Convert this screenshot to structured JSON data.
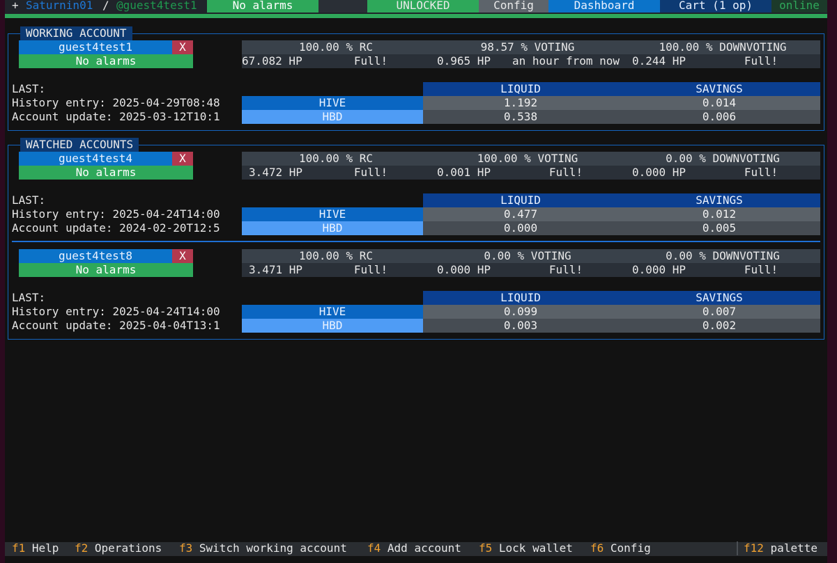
{
  "header": {
    "plus": "+",
    "profile": "Saturnin01",
    "slash": "/",
    "account": "@guest4test1",
    "alarms": "No alarms",
    "lock_status": "UNLOCKED",
    "config": "Config",
    "dashboard": "Dashboard",
    "cart": "Cart (1 op)",
    "status": "online"
  },
  "working": {
    "title": "WORKING ACCOUNT",
    "name": "guest4test1",
    "remove": "X",
    "alarms": "No alarms",
    "rc": "100.00 % RC",
    "voting": "98.57 % VOTING",
    "downvoting": "100.00 % DOWNVOTING",
    "hp": "67.082 HP",
    "hp_status": "Full!",
    "voting_hp": "0.965 HP",
    "voting_status": "an hour from now",
    "down_hp": "0.244 HP",
    "down_status": "Full!",
    "last": "LAST:",
    "history": "History entry: 2025-04-29T08:48",
    "update": "Account update: 2025-03-12T10:1",
    "liquid": "LIQUID",
    "savings": "SAVINGS",
    "hive": "HIVE",
    "hbd": "HBD",
    "hive_liquid": "1.192",
    "hive_savings": "0.014",
    "hbd_liquid": "0.538",
    "hbd_savings": "0.006"
  },
  "watched_title": "WATCHED ACCOUNTS",
  "watched": [
    {
      "name": "guest4test4",
      "remove": "X",
      "alarms": "No alarms",
      "rc": "100.00 % RC",
      "voting": "100.00 % VOTING",
      "downvoting": "0.00 % DOWNVOTING",
      "hp": "3.472 HP",
      "hp_status": "Full!",
      "voting_hp": "0.001 HP",
      "voting_status": "Full!",
      "down_hp": "0.000 HP",
      "down_status": "Full!",
      "last": "LAST:",
      "history": "History entry: 2025-04-24T14:00",
      "update": "Account update: 2024-02-20T12:5",
      "liquid": "LIQUID",
      "savings": "SAVINGS",
      "hive": "HIVE",
      "hbd": "HBD",
      "hive_liquid": "0.477",
      "hive_savings": "0.012",
      "hbd_liquid": "0.000",
      "hbd_savings": "0.005"
    },
    {
      "name": "guest4test8",
      "remove": "X",
      "alarms": "No alarms",
      "rc": "100.00 % RC",
      "voting": "0.00 % VOTING",
      "downvoting": "0.00 % DOWNVOTING",
      "hp": "3.471 HP",
      "hp_status": "Full!",
      "voting_hp": "0.000 HP",
      "voting_status": "Full!",
      "down_hp": "0.000 HP",
      "down_status": "Full!",
      "last": "LAST:",
      "history": "History entry: 2025-04-24T14:00",
      "update": "Account update: 2025-04-04T13:1",
      "liquid": "LIQUID",
      "savings": "SAVINGS",
      "hive": "HIVE",
      "hbd": "HBD",
      "hive_liquid": "0.099",
      "hive_savings": "0.007",
      "hbd_liquid": "0.003",
      "hbd_savings": "0.002"
    }
  ],
  "footer": [
    {
      "key": "f1",
      "label": "Help"
    },
    {
      "key": "f2",
      "label": "Operations"
    },
    {
      "key": "f3",
      "label": "Switch working account"
    },
    {
      "key": "f4",
      "label": "Add account"
    },
    {
      "key": "f5",
      "label": "Lock wallet"
    },
    {
      "key": "f6",
      "label": "Config"
    },
    {
      "key": "f12",
      "label": "palette"
    }
  ],
  "colors": {
    "accent": "#0b73c9",
    "ok": "#2ea85a",
    "danger": "#b2394e",
    "hotkey": "#f0a030"
  }
}
